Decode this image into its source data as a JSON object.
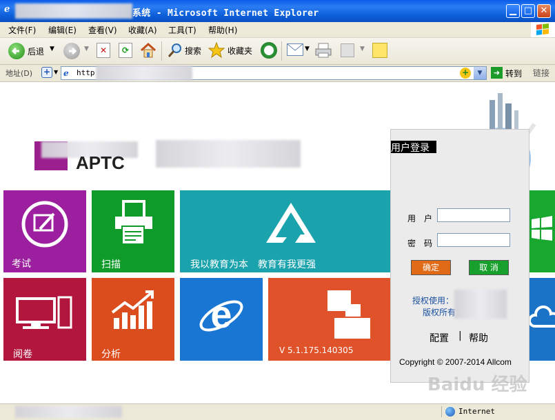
{
  "window": {
    "title": "系统 - Microsoft Internet Explorer"
  },
  "menu": [
    "文件(F)",
    "编辑(E)",
    "查看(V)",
    "收藏(A)",
    "工具(T)",
    "帮助(H)"
  ],
  "toolbar": {
    "back_label": "后退",
    "search_label": "搜索",
    "favorites_label": "收藏夹"
  },
  "address": {
    "label": "地址(D)",
    "value": "http",
    "go_label": "转到",
    "links_label": "链接"
  },
  "header": {
    "logo_text": "APTC"
  },
  "tiles": {
    "exam": "考试",
    "scan": "扫描",
    "slogan": "我以教育为本　教育有我更强",
    "review": "阅卷",
    "analysis": "分析",
    "version": "V 5.1.175.140305"
  },
  "login": {
    "heading": "用户登录",
    "user_label": "用　户",
    "password_label": "密　码",
    "user_value": "",
    "password_value": "",
    "confirm_label": "确定",
    "cancel_label": "取 消",
    "licensed_to": "授权使用：",
    "copyright_owner": "版权所有：",
    "config_link": "配置",
    "help_link": "帮助",
    "divider": "|",
    "copyright": "Copyright © 2007-2014 Allcom"
  },
  "status": {
    "zone": "Internet"
  },
  "watermark": "Baidu 经验",
  "colors": {
    "exam": "#9b1f9e",
    "scan": "#0f9b29",
    "slogan": "#1ba3ad",
    "review": "#b2163e",
    "analysis": "#dc4d1e",
    "ie": "#1976d2",
    "about": "#e0522a",
    "confirm": "#e06a16",
    "cancel": "#17a02c"
  }
}
